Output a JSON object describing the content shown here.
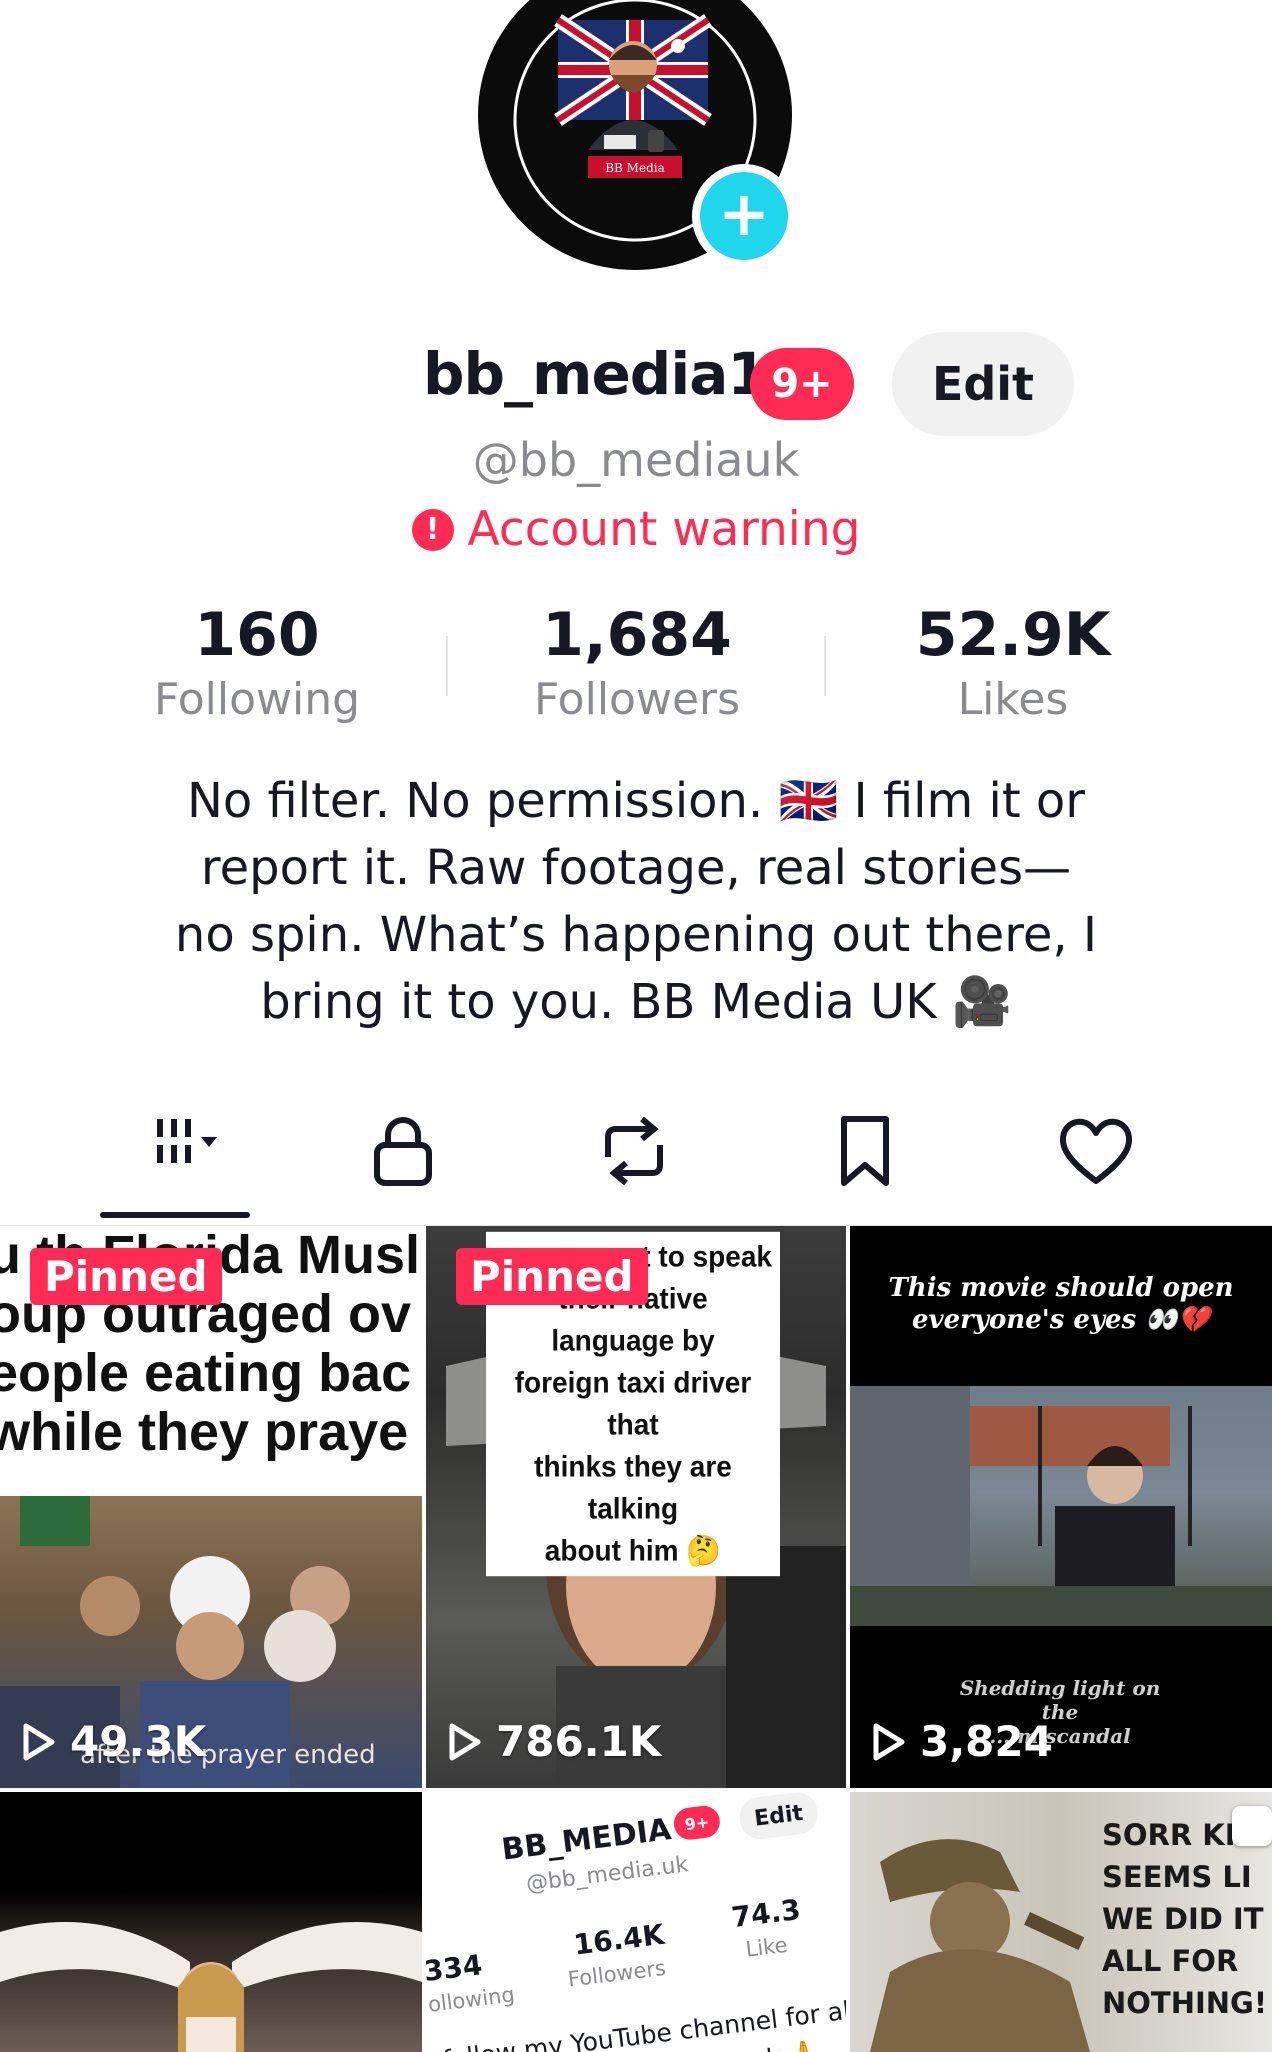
{
  "profile": {
    "display_name": "bb_media1",
    "notification_badge": "9+",
    "edit_label": "Edit",
    "handle": "@bb_mediauk",
    "warning_icon": "!",
    "warning_text": "Account warning",
    "add_icon": "+"
  },
  "stats": [
    {
      "value": "160",
      "label": "Following"
    },
    {
      "value": "1,684",
      "label": "Followers"
    },
    {
      "value": "52.9K",
      "label": "Likes"
    }
  ],
  "bio": {
    "line1": "No filter. No permission. 🇬🇧 I film it or",
    "line2": "report it. Raw footage, real stories—",
    "line3": "no spin. What’s happening out there, I",
    "line4": "bring it to you. BB Media UK 🎥"
  },
  "tabs": [
    {
      "name": "videos-grid-icon",
      "active": true
    },
    {
      "name": "private-lock-icon",
      "active": false
    },
    {
      "name": "reposts-icon",
      "active": false
    },
    {
      "name": "favorites-bookmark-icon",
      "active": false
    },
    {
      "name": "liked-heart-icon",
      "active": false
    }
  ],
  "videos": [
    {
      "pinned_label": "Pinned",
      "views": "49.3K",
      "overlay_lines": [
        "u th Florida Musl",
        "oup outraged ov",
        "eople eating bac",
        "while they praye"
      ],
      "caption": "after the prayer ended"
    },
    {
      "pinned_label": "Pinned",
      "views": "786.1K",
      "overlay_lines": [
        "... not to speak",
        "their native language by",
        "foreign taxi driver that",
        "thinks they are talking",
        "about him 🤔"
      ]
    },
    {
      "views": "3,824",
      "overlay_lines": [
        "This movie should open",
        "everyone's eyes 👀💔"
      ],
      "footer_lines": [
        "Shedding light on the",
        "... m scandal"
      ]
    },
    {
      "views": ""
    },
    {
      "screenshot": {
        "name": "BB_MEDIA",
        "badge": "9+",
        "edit": "Edit",
        "handle": "@bb_media.uk",
        "following_value": "334",
        "following_label": "ollowing",
        "followers_value": "16.4K",
        "followers_label": "Followers",
        "likes_value": "74.3",
        "likes_label": "Like",
        "bio_line1": "follow my YouTube channel for all n",
        "bio_line2": "... lives  bb_media_uk 🙏"
      }
    },
    {
      "overlay_lines": [
        "SORR  KI",
        "SEEMS LI",
        "WE DID IT",
        "ALL FOR",
        "NOTHING!"
      ]
    }
  ],
  "colors": {
    "accent_pink": "#fe2c55",
    "accent_cyan": "#20d5ec",
    "text_primary": "#161823",
    "text_secondary": "#8a8b91"
  }
}
